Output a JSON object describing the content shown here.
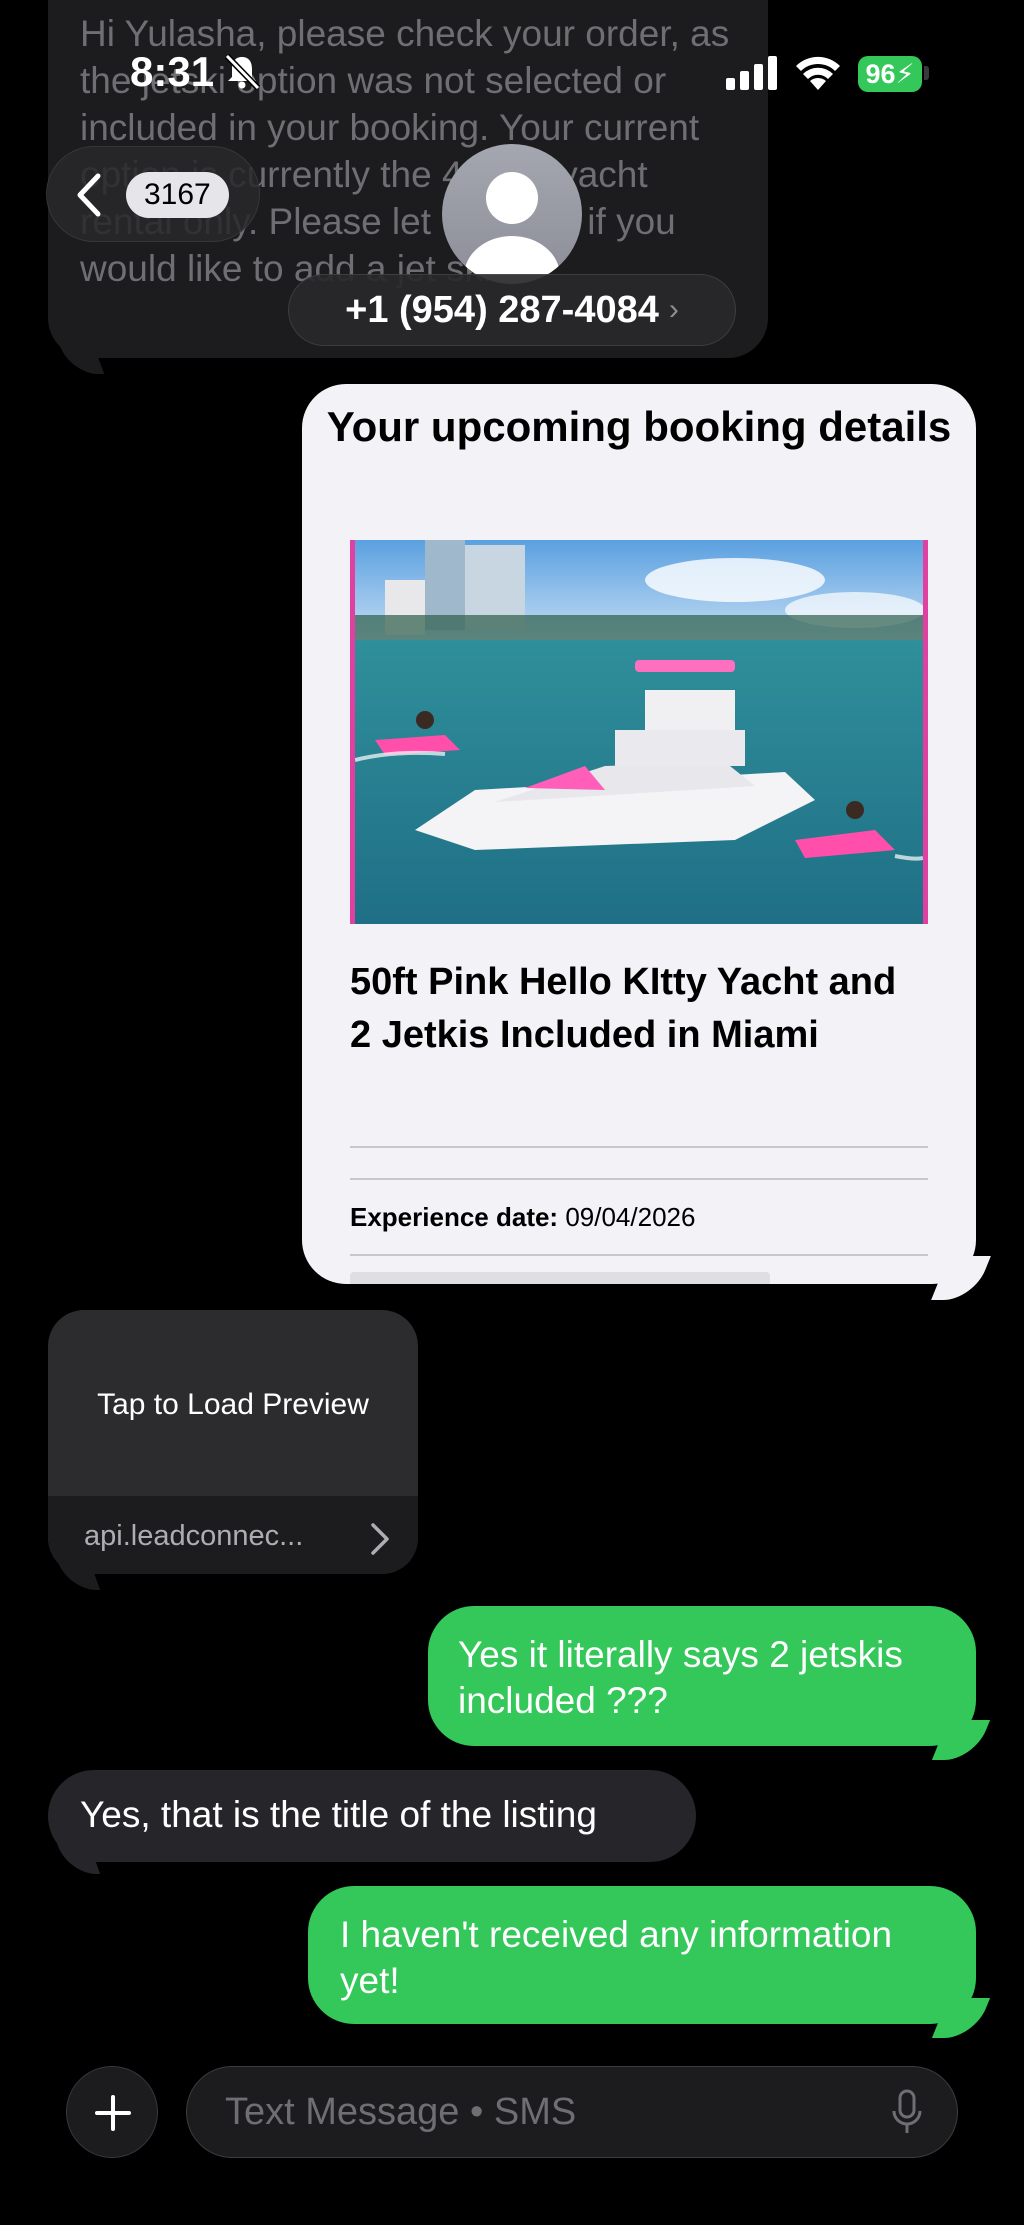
{
  "status_bar": {
    "time": "8:31",
    "battery": "96"
  },
  "nav": {
    "back_count": "3167",
    "contact": "+1 (954) 287-4084",
    "contact_chevron": "›"
  },
  "messages": {
    "top_incoming": "Hi Yulasha, please check your order, as the jetski option was not selected or included in your booking. Your current option is currently the 4-hour yacht rental only. Please let us know if you would like to add a jet ski.",
    "booking_card": {
      "header": "Your upcoming booking details",
      "listing_title": "50ft Pink Hello KItty Yacht and 2 Jetkis Included in Miami",
      "experience_date_label": "Experience date:",
      "experience_date_value": "09/04/2026",
      "image_icon": "yacht-photo"
    },
    "link_preview": {
      "label": "Tap to Load Preview",
      "domain": "api.leadconnec..."
    },
    "outgoing_1": "Yes it literally says 2 jetskis included ???",
    "incoming_1": "Yes,  that  is the title of the listing",
    "outgoing_2": "I haven't received any information yet!"
  },
  "input": {
    "placeholder": "Text Message • SMS"
  },
  "colors": {
    "imessage_green": "#34c759",
    "bubble_grey": "#26262a",
    "background": "#000000"
  }
}
